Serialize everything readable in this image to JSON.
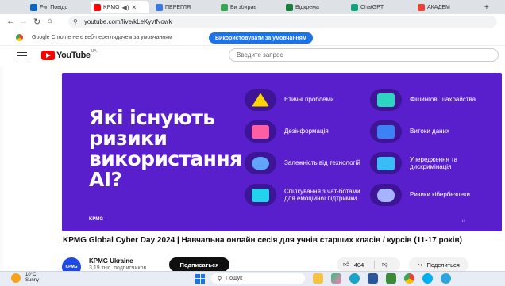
{
  "browser": {
    "tabs": [
      {
        "label": "Fw: Повідо",
        "color": "#0a66c2",
        "active": false
      },
      {
        "label": "KPMG",
        "color": "#ff0000",
        "active": true
      },
      {
        "label": "ПЕРЕГЛЯ",
        "color": "#3b78e7",
        "active": false
      },
      {
        "label": "Ви збирає",
        "color": "#34a853",
        "active": false
      },
      {
        "label": "Відкрема",
        "color": "#188038",
        "active": false
      },
      {
        "label": "ChatGPT",
        "color": "#10a37f",
        "active": false
      },
      {
        "label": "АКАДЕМ",
        "color": "#ea4335",
        "active": false
      }
    ],
    "url": "youtube.com/live/kLeKyvtNowk",
    "infobar_text": "Google Chrome не є веб-переглядачем за умовчанням",
    "infobar_button": "Використовувати за умовчанням"
  },
  "youtube": {
    "logo": "YouTube",
    "region": "UA",
    "search_placeholder": "Введите запрос"
  },
  "video": {
    "headline": "Які існують ризики використання AI?",
    "cards": [
      {
        "label": "Етичні проблеми",
        "icon": "warning-icon",
        "color": "#ffd400"
      },
      {
        "label": "Фішингові шахрайства",
        "icon": "phishing-icon",
        "color": "#2dd4bf"
      },
      {
        "label": "Дезінформація",
        "icon": "monitor-icon",
        "color": "#ff5fa2"
      },
      {
        "label": "Витоки даних",
        "icon": "data-leak-icon",
        "color": "#3b82f6"
      },
      {
        "label": "Залежність від технологій",
        "icon": "eye-icon",
        "color": "#60a5fa"
      },
      {
        "label": "Упередження та дискримінація",
        "icon": "laptop-icon",
        "color": "#38bdf8"
      },
      {
        "label": "Спілкування з чат-ботами для емоційної підтримки",
        "icon": "chatbot-icon",
        "color": "#22d3ee"
      },
      {
        "label": "Ризики кібербезпеки",
        "icon": "vr-icon",
        "color": "#a5b4fc"
      }
    ],
    "page_number": "13"
  },
  "watch": {
    "title": "KPMG Global Cyber Day 2024 | Навчальна онлайн сесія для учнів старших класів / курсів (11-17 років)",
    "channel": "KPMG Ukraine",
    "subscribers": "3,19 тыс. подписчиков",
    "subscribe_label": "Подписаться",
    "likes": "404",
    "share_label": "Поделиться"
  },
  "taskbar": {
    "temperature": "10°C",
    "condition": "Sunny",
    "search_placeholder": "Пошук"
  }
}
